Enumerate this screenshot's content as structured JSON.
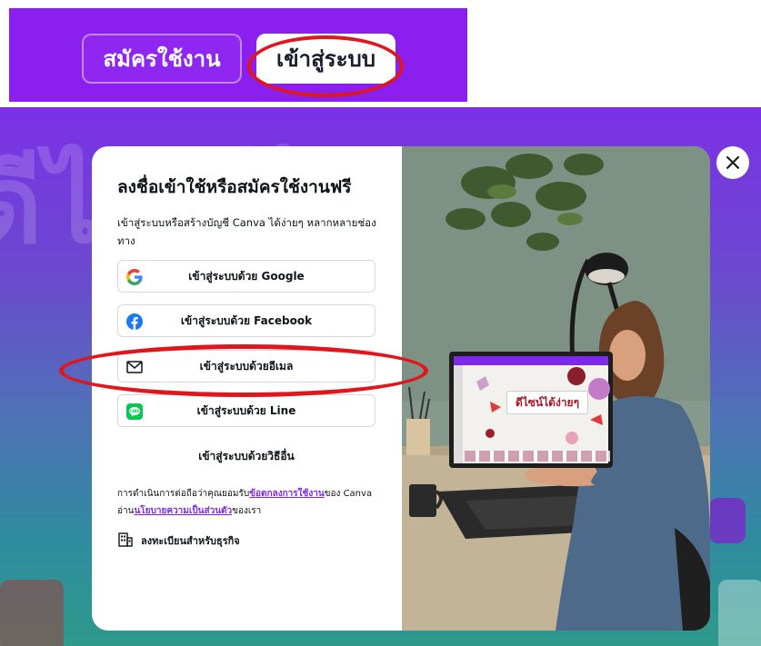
{
  "header": {
    "signup_label": "สมัครใช้งาน",
    "login_label": "เข้าสู่ระบบ"
  },
  "background": {
    "text": "ดีไซน์ได้ง่ายๆ"
  },
  "close_glyph": "×",
  "modal": {
    "title": "ลงชื่อเข้าใช้หรือสมัครใช้งานฟรี",
    "subtitle": "เข้าสู่ระบบหรือสร้างบัญชี Canva ได้ง่ายๆ หลากหลายช่องทาง",
    "options": [
      {
        "label": "เข้าสู่ระบบด้วย Google",
        "icon": "google-icon"
      },
      {
        "label": "เข้าสู่ระบบด้วย Facebook",
        "icon": "facebook-icon"
      },
      {
        "label": "เข้าสู่ระบบด้วยอีเมล",
        "icon": "mail-icon"
      },
      {
        "label": "เข้าสู่ระบบด้วย Line",
        "icon": "line-icon"
      }
    ],
    "other_label": "เข้าสู่ระบบด้วยวิธีอื่น",
    "terms": {
      "prefix": "การดำเนินการต่อถือว่าคุณยอมรับ",
      "terms_link": "ข้อตกลงการใช้งาน",
      "middle": "ของ Canva อ่าน",
      "privacy_link": "นโยบายความเป็นส่วนตัว",
      "suffix": "ของเรา"
    },
    "business_label": "ลงทะเบียนสำหรับธุรกิจ",
    "illustration_text": "ดีไซน์ได้ง่ายๆ"
  },
  "colors": {
    "brand_purple": "#8b1ff0",
    "highlight_red": "#e0161c",
    "link_purple": "#7d2ae8"
  }
}
